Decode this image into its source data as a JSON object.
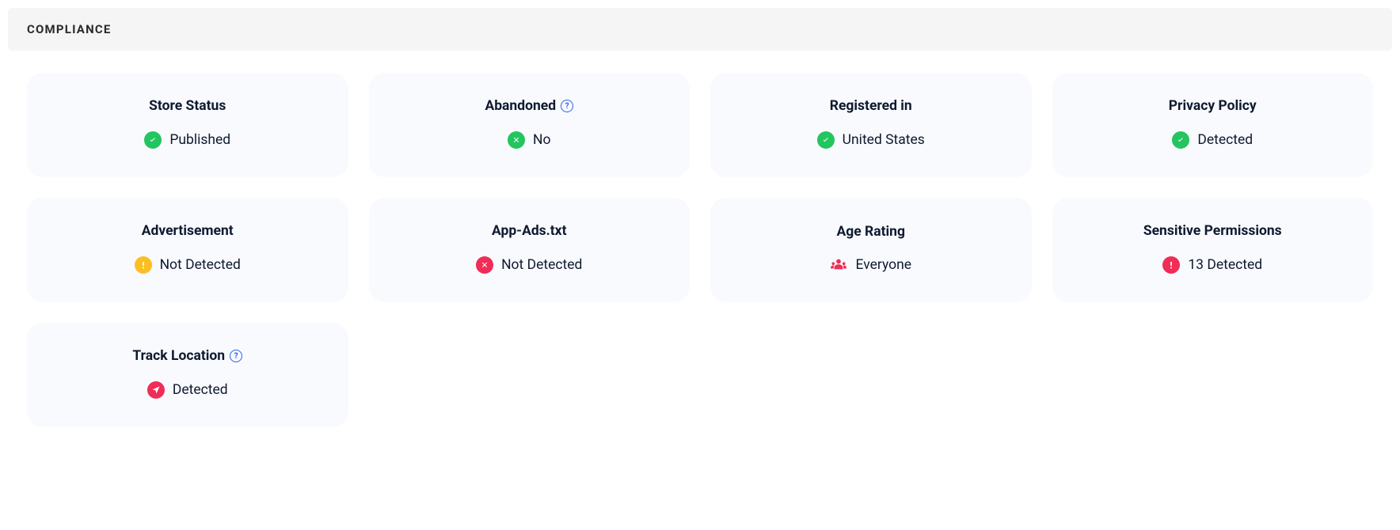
{
  "header": {
    "title": "COMPLIANCE"
  },
  "cards": [
    {
      "title": "Store Status",
      "value": "Published",
      "icon": "check-green",
      "help": false
    },
    {
      "title": "Abandoned",
      "value": "No",
      "icon": "x-green",
      "help": true
    },
    {
      "title": "Registered in",
      "value": "United States",
      "icon": "check-green",
      "help": false
    },
    {
      "title": "Privacy Policy",
      "value": "Detected",
      "icon": "check-green",
      "help": false
    },
    {
      "title": "Advertisement",
      "value": "Not Detected",
      "icon": "exclaim-orange",
      "help": false
    },
    {
      "title": "App-Ads.txt",
      "value": "Not Detected",
      "icon": "x-red",
      "help": false
    },
    {
      "title": "Age Rating",
      "value": "Everyone",
      "icon": "people-red",
      "help": false
    },
    {
      "title": "Sensitive Permissions",
      "value": "13 Detected",
      "icon": "exclaim-red",
      "help": false
    },
    {
      "title": "Track Location",
      "value": "Detected",
      "icon": "location-red",
      "help": true
    }
  ]
}
